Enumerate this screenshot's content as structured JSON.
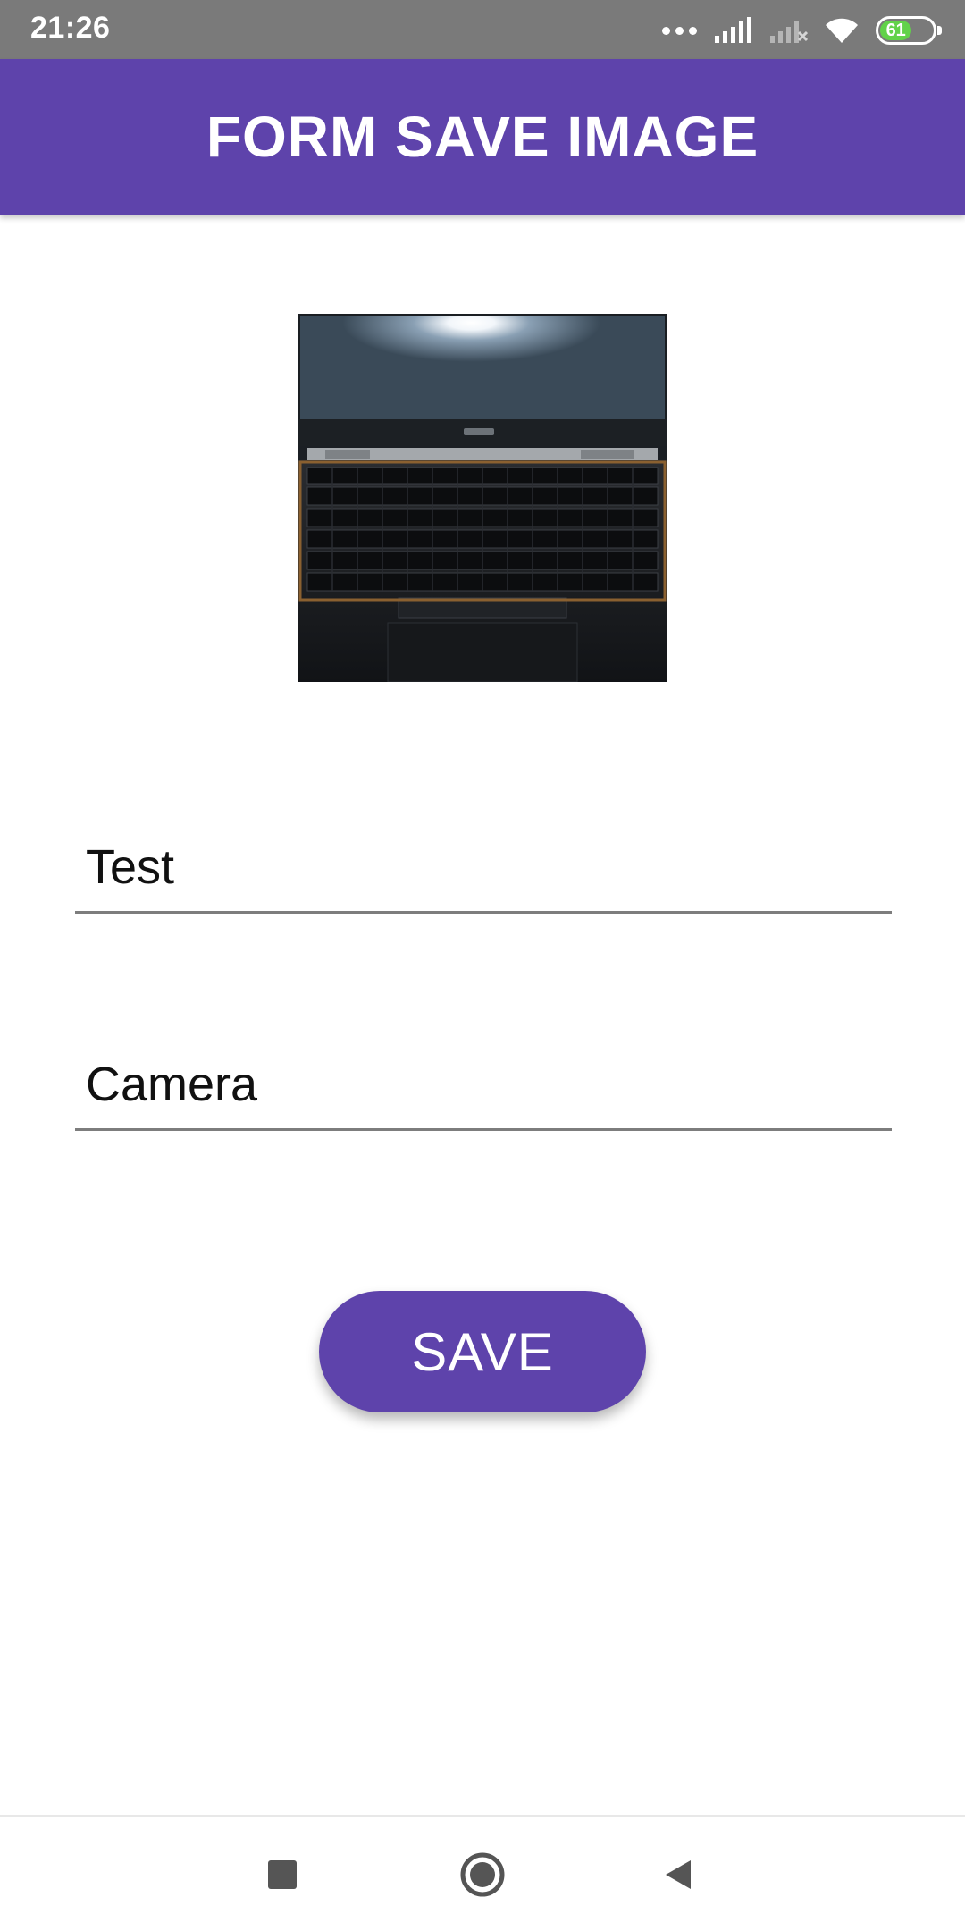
{
  "status_bar": {
    "time": "21:26",
    "battery_level": "61",
    "icons": [
      "more-dots-icon",
      "signal-icon",
      "signal-no-service-icon",
      "wifi-icon",
      "battery-icon"
    ]
  },
  "app_bar": {
    "title": "FORM SAVE IMAGE",
    "color": "#5e43ab"
  },
  "form": {
    "image_subject": "laptop keyboard photo",
    "name_field": {
      "value": "Test"
    },
    "description_field": {
      "value": "Camera"
    },
    "save_label": "SAVE"
  },
  "nav_bar": {
    "icons": [
      "recents-square-icon",
      "home-circle-icon",
      "back-triangle-icon"
    ]
  },
  "colors": {
    "accent": "#5e43ab",
    "status_bar": "#7a7a7a",
    "battery": "#62d24a"
  }
}
